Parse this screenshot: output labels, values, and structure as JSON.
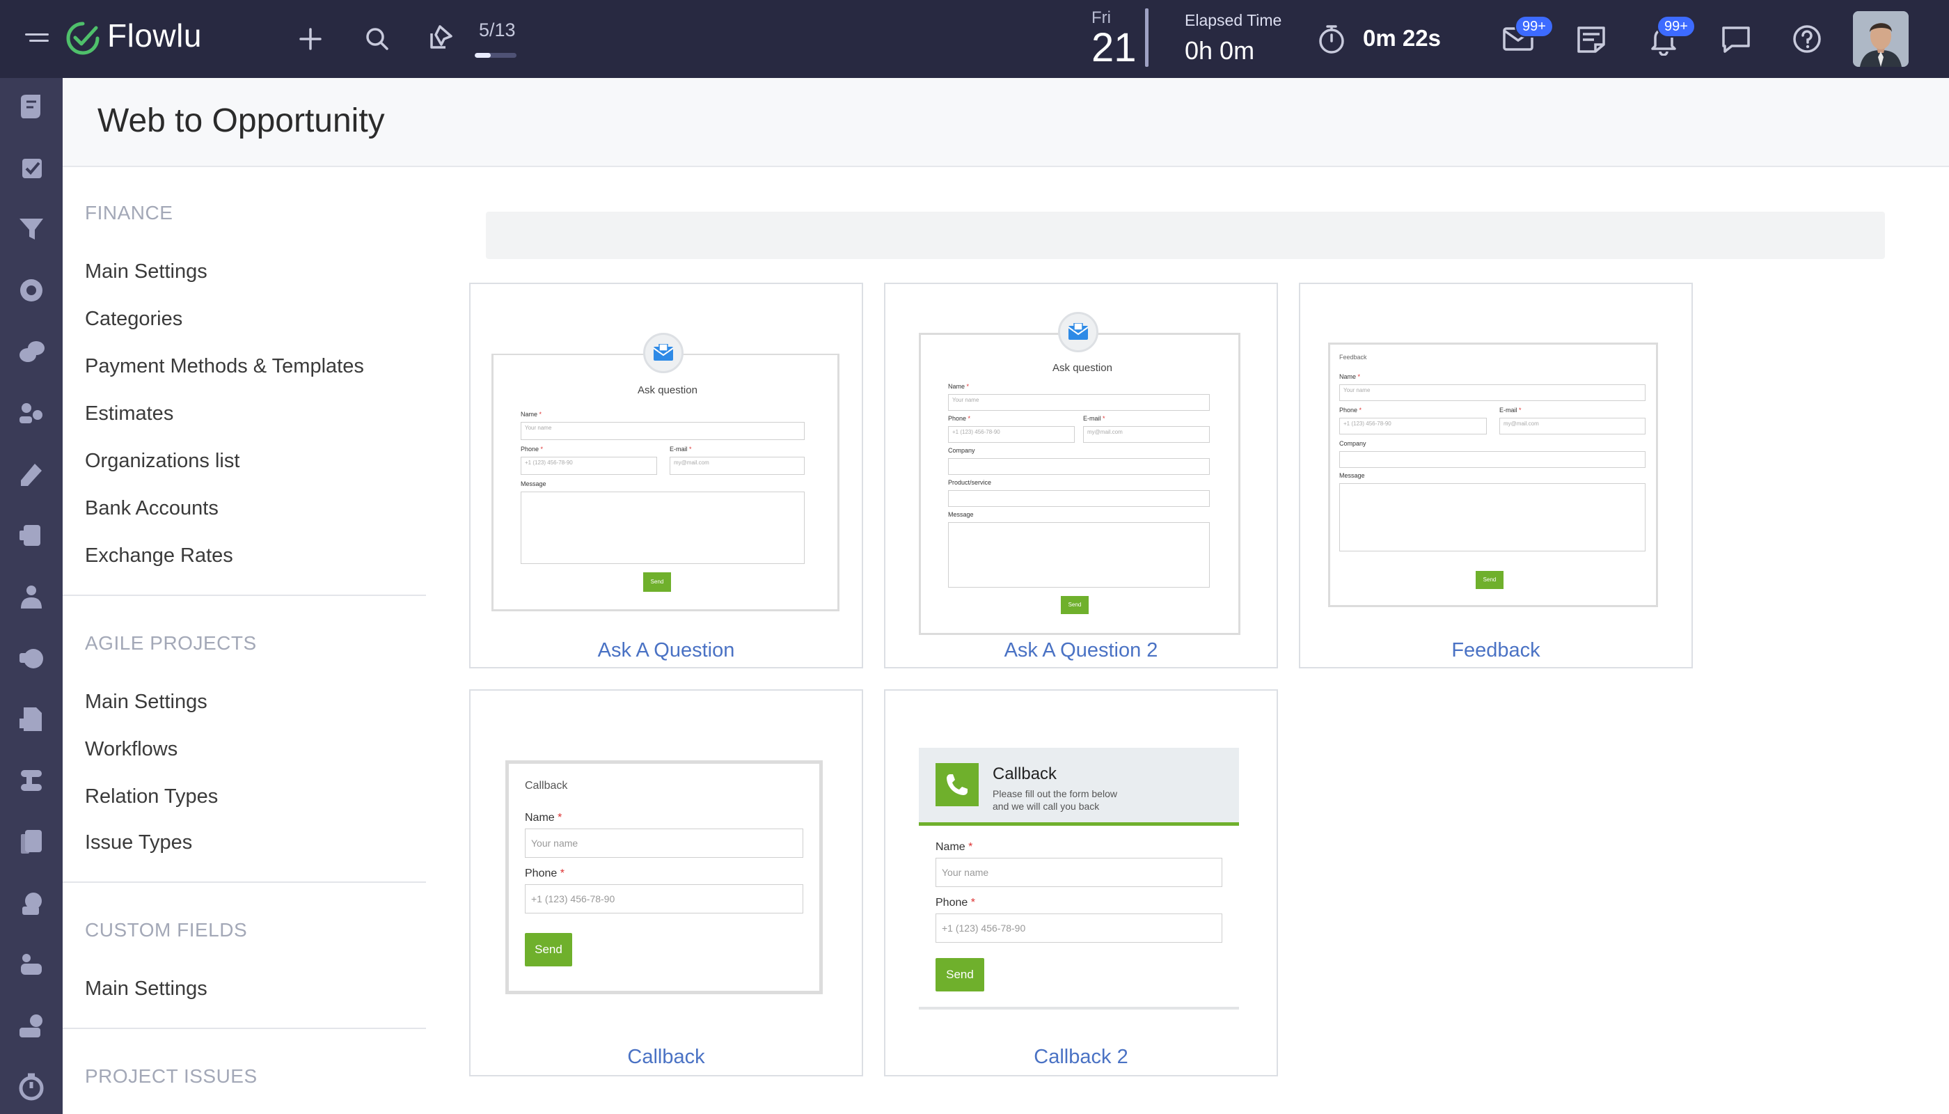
{
  "app": {
    "name": "Flowlu",
    "counter": {
      "text": "5/13",
      "progress": 0.385
    },
    "date": {
      "day_name": "Fri",
      "day_number": "21"
    },
    "elapsed": {
      "label": "Elapsed Time",
      "value": "0h 0m"
    },
    "timer": {
      "value": "0m 22s"
    },
    "badges": {
      "mail": "99+",
      "notifications": "99+"
    },
    "icons": [
      "menu-icon",
      "logo-check-icon",
      "plus-icon",
      "search-icon",
      "pin-icon",
      "stopwatch-icon",
      "mail-icon",
      "notes-icon",
      "bell-icon",
      "chat-icon",
      "help-icon"
    ]
  },
  "page": {
    "title": "Web to Opportunity"
  },
  "settings_nav": {
    "sections": [
      {
        "title": "FINANCE",
        "items": [
          "Main Settings",
          "Categories",
          "Payment Methods & Templates",
          "Estimates",
          "Organizations list",
          "Bank Accounts",
          "Exchange Rates"
        ]
      },
      {
        "title": "AGILE PROJECTS",
        "items": [
          "Main Settings",
          "Workflows",
          "Relation Types",
          "Issue Types"
        ]
      },
      {
        "title": "CUSTOM FIELDS",
        "items": [
          "Main Settings"
        ]
      },
      {
        "title": "PROJECT ISSUES",
        "items": []
      }
    ]
  },
  "templates": [
    {
      "label": "Ask A Question",
      "preview": {
        "title": "Ask question",
        "name_label": "Name",
        "name_ph": "Your name",
        "phone_label": "Phone",
        "phone_ph": "+1 (123) 456-78-90",
        "email_label": "E-mail",
        "email_ph": "my@mail.com",
        "message_label": "Message",
        "button": "Send"
      }
    },
    {
      "label": "Ask A Question 2",
      "preview": {
        "title": "Ask question",
        "name_label": "Name",
        "name_ph": "Your name",
        "phone_label": "Phone",
        "phone_ph": "+1 (123) 456-78-90",
        "email_label": "E-mail",
        "email_ph": "my@mail.com",
        "company_label": "Company",
        "product_label": "Product/service",
        "message_label": "Message",
        "button": "Send"
      }
    },
    {
      "label": "Feedback",
      "preview": {
        "title": "Feedback",
        "name_label": "Name",
        "name_ph": "Your name",
        "phone_label": "Phone",
        "phone_ph": "+1 (123) 456-78-90",
        "email_label": "E-mail",
        "email_ph": "my@mail.com",
        "company_label": "Company",
        "message_label": "Message",
        "button": "Send"
      }
    },
    {
      "label": "Callback",
      "preview": {
        "title": "Callback",
        "name_label": "Name",
        "name_ph": "Your name",
        "phone_label": "Phone",
        "phone_ph": "+1 (123) 456-78-90",
        "button": "Send"
      }
    },
    {
      "label": "Callback 2",
      "preview": {
        "title": "Callback",
        "subtitle_1": "Please fill out the form below",
        "subtitle_2": "and we will call you back",
        "name_label": "Name",
        "name_ph": "Your name",
        "phone_label": "Phone",
        "phone_ph": "+1 (123) 456-78-90",
        "button": "Send"
      }
    }
  ],
  "colors": {
    "topbar": "#282941",
    "rail": "#3a3b57",
    "accent_link": "#4a72c4",
    "badge": "#3d6bff",
    "send_button": "#6fb02c",
    "logo_check": "#4fc06b"
  }
}
